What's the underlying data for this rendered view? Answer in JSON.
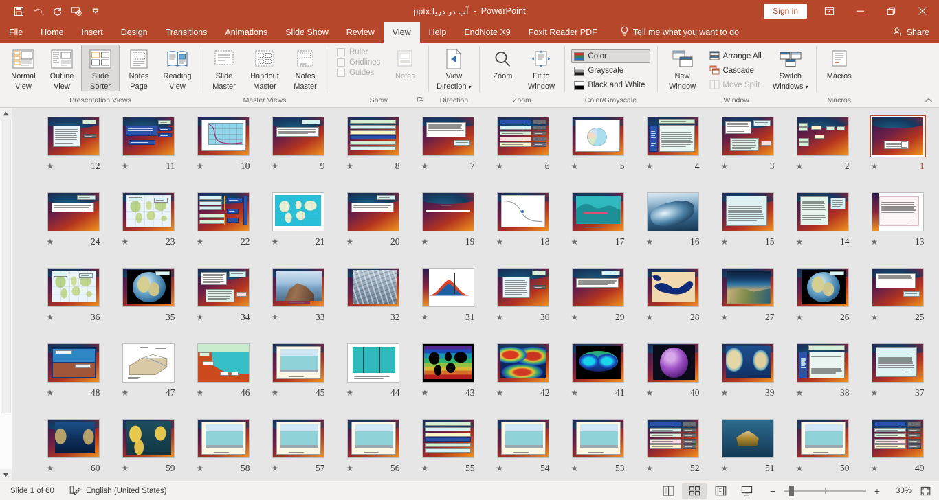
{
  "app": {
    "title_document": "آب در دریا.pptx",
    "title_separator": "-",
    "title_app": "PowerPoint",
    "accent_color": "#b7472a",
    "canvas_color": "#e6e6e6"
  },
  "quick_access": [
    {
      "name": "save-button",
      "icon": "save-icon",
      "enabled": true
    },
    {
      "name": "undo-button",
      "icon": "undo-icon",
      "enabled": false
    },
    {
      "name": "redo-button",
      "icon": "redo-icon",
      "enabled": true
    },
    {
      "name": "start-presentation-button",
      "icon": "present-icon",
      "enabled": true
    },
    {
      "name": "customize-qat-button",
      "icon": "chevron-down-icon",
      "enabled": true
    }
  ],
  "titlebar": {
    "sign_in_label": "Sign in",
    "ribbon_display_icon": "ribbon-display-options-icon",
    "minimize_icon": "minimize-icon",
    "restore_icon": "restore-icon",
    "close_icon": "close-icon"
  },
  "tabs": [
    {
      "label": "File",
      "active": false
    },
    {
      "label": "Home",
      "active": false
    },
    {
      "label": "Insert",
      "active": false
    },
    {
      "label": "Design",
      "active": false
    },
    {
      "label": "Transitions",
      "active": false
    },
    {
      "label": "Animations",
      "active": false
    },
    {
      "label": "Slide Show",
      "active": false
    },
    {
      "label": "Review",
      "active": false
    },
    {
      "label": "View",
      "active": true
    },
    {
      "label": "Help",
      "active": false
    },
    {
      "label": "EndNote X9",
      "active": false
    },
    {
      "label": "Foxit Reader PDF",
      "active": false
    }
  ],
  "tell_me": {
    "label": "Tell me what you want to do",
    "icon": "lightbulb-icon"
  },
  "share": {
    "label": "Share",
    "icon": "share-person-icon"
  },
  "ribbon": {
    "groups": [
      {
        "label": "Presentation Views",
        "buttons": [
          {
            "label_top": "Normal",
            "label_bottom": "View",
            "icon": "normal-view-icon",
            "selected": false,
            "enabled": true
          },
          {
            "label_top": "Outline",
            "label_bottom": "View",
            "icon": "outline-view-icon",
            "selected": false,
            "enabled": true
          },
          {
            "label_top": "Slide",
            "label_bottom": "Sorter",
            "icon": "slide-sorter-icon",
            "selected": true,
            "enabled": true
          },
          {
            "label_top": "Notes",
            "label_bottom": "Page",
            "icon": "notes-page-icon",
            "selected": false,
            "enabled": true
          },
          {
            "label_top": "Reading",
            "label_bottom": "View",
            "icon": "reading-view-icon",
            "selected": false,
            "enabled": true
          }
        ]
      },
      {
        "label": "Master Views",
        "buttons": [
          {
            "label_top": "Slide",
            "label_bottom": "Master",
            "icon": "slide-master-icon",
            "selected": false,
            "enabled": true
          },
          {
            "label_top": "Handout",
            "label_bottom": "Master",
            "icon": "handout-master-icon",
            "selected": false,
            "enabled": true
          },
          {
            "label_top": "Notes",
            "label_bottom": "Master",
            "icon": "notes-master-icon",
            "selected": false,
            "enabled": true
          }
        ]
      },
      {
        "label": "Show",
        "has_dialog_launcher": true,
        "checkboxes": [
          {
            "label": "Ruler",
            "checked": false,
            "enabled": false
          },
          {
            "label": "Gridlines",
            "checked": false,
            "enabled": false
          },
          {
            "label": "Guides",
            "checked": false,
            "enabled": false
          }
        ],
        "buttons": [
          {
            "label_top": "Notes",
            "label_bottom": "",
            "icon": "notes-icon",
            "selected": false,
            "enabled": false
          }
        ]
      },
      {
        "label": "Direction",
        "buttons": [
          {
            "label_top": "View",
            "label_bottom": "Direction",
            "icon": "view-direction-icon",
            "has_dropdown": true,
            "selected": false,
            "enabled": true
          }
        ]
      },
      {
        "label": "Zoom",
        "buttons": [
          {
            "label_top": "Zoom",
            "label_bottom": "",
            "icon": "magnifier-icon",
            "selected": false,
            "enabled": true
          },
          {
            "label_top": "Fit to",
            "label_bottom": "Window",
            "icon": "fit-to-window-icon",
            "selected": false,
            "enabled": true
          }
        ]
      },
      {
        "label": "Color/Grayscale",
        "small_buttons": [
          {
            "label": "Color",
            "icon": "color-swatch-icon",
            "selected": true,
            "enabled": true
          },
          {
            "label": "Grayscale",
            "icon": "grayscale-swatch-icon",
            "selected": false,
            "enabled": true
          },
          {
            "label": "Black and White",
            "icon": "blackwhite-swatch-icon",
            "selected": false,
            "enabled": true
          }
        ]
      },
      {
        "label": "Window",
        "buttons": [
          {
            "label_top": "New",
            "label_bottom": "Window",
            "icon": "new-window-icon",
            "selected": false,
            "enabled": true
          },
          {
            "label_top": "Switch",
            "label_bottom": "Windows",
            "icon": "switch-windows-icon",
            "has_dropdown": true,
            "selected": false,
            "enabled": true
          }
        ],
        "small_buttons": [
          {
            "label": "Arrange All",
            "icon": "arrange-all-icon",
            "selected": false,
            "enabled": true
          },
          {
            "label": "Cascade",
            "icon": "cascade-icon",
            "selected": false,
            "enabled": true
          },
          {
            "label": "Move Split",
            "icon": "move-split-icon",
            "selected": false,
            "enabled": false
          }
        ]
      },
      {
        "label": "Macros",
        "buttons": [
          {
            "label_top": "Macros",
            "label_bottom": "",
            "icon": "macros-icon",
            "selected": false,
            "enabled": true
          }
        ]
      }
    ],
    "collapse_icon": "chevron-up-icon"
  },
  "sorter": {
    "selected_slide": 1,
    "rtl": true,
    "slides": [
      {
        "n": 1,
        "star": true,
        "style": "title-slide",
        "selected": true
      },
      {
        "n": 2,
        "star": true,
        "style": "diagram-boxes"
      },
      {
        "n": 3,
        "star": true,
        "style": "two-text-boxes"
      },
      {
        "n": 4,
        "star": true,
        "style": "blue-list"
      },
      {
        "n": 5,
        "star": true,
        "style": "pie-chart"
      },
      {
        "n": 6,
        "star": true,
        "style": "table-rows"
      },
      {
        "n": 7,
        "star": true,
        "style": "text-dark"
      },
      {
        "n": 8,
        "star": true,
        "style": "table-green"
      },
      {
        "n": 9,
        "star": true,
        "style": "text-block"
      },
      {
        "n": 10,
        "star": true,
        "style": "profile-chart"
      },
      {
        "n": 11,
        "star": true,
        "style": "blue-buttons"
      },
      {
        "n": 12,
        "star": true,
        "style": "text-white-box"
      },
      {
        "n": 13,
        "star": true,
        "style": "pink-text"
      },
      {
        "n": 14,
        "star": true,
        "style": "text-green"
      },
      {
        "n": 15,
        "star": true,
        "style": "text-cyan"
      },
      {
        "n": 16,
        "star": true,
        "style": "photo-wave"
      },
      {
        "n": 17,
        "star": true,
        "style": "sea-profile"
      },
      {
        "n": 18,
        "star": true,
        "style": "scurve-chart"
      },
      {
        "n": 19,
        "star": true,
        "style": "bar-white"
      },
      {
        "n": 20,
        "star": true,
        "style": "text-block"
      },
      {
        "n": 21,
        "star": true,
        "style": "map-ocean"
      },
      {
        "n": 22,
        "star": true,
        "style": "diagram-brace"
      },
      {
        "n": 23,
        "star": true,
        "style": "map-world"
      },
      {
        "n": 24,
        "star": true,
        "style": "text-block"
      },
      {
        "n": 25,
        "star": true,
        "style": "text-dark"
      },
      {
        "n": 26,
        "star": true,
        "style": "globe-dark"
      },
      {
        "n": 27,
        "star": true,
        "style": "photo-coast"
      },
      {
        "n": 28,
        "star": true,
        "style": "map-medit"
      },
      {
        "n": 29,
        "star": true,
        "style": "text-block"
      },
      {
        "n": 30,
        "star": true,
        "style": "text-white-box"
      },
      {
        "n": 31,
        "star": true,
        "style": "section-diagram"
      },
      {
        "n": 32,
        "star": false,
        "style": "photo-city"
      },
      {
        "n": 33,
        "star": true,
        "style": "photo-rock"
      },
      {
        "n": 34,
        "star": true,
        "style": "two-text-boxes"
      },
      {
        "n": 35,
        "star": false,
        "style": "globe-dark"
      },
      {
        "n": 36,
        "star": true,
        "style": "map-world"
      },
      {
        "n": 37,
        "star": true,
        "style": "text-cyan"
      },
      {
        "n": 38,
        "star": true,
        "style": "blue-list"
      },
      {
        "n": 39,
        "star": true,
        "style": "map-bathy"
      },
      {
        "n": 40,
        "star": true,
        "style": "map-purple"
      },
      {
        "n": 41,
        "star": true,
        "style": "map-ellipse"
      },
      {
        "n": 42,
        "star": true,
        "style": "map-salin"
      },
      {
        "n": 43,
        "star": true,
        "style": "map-sst"
      },
      {
        "n": 44,
        "star": true,
        "style": "profile-deep"
      },
      {
        "n": 45,
        "star": true,
        "style": "sea-chart"
      },
      {
        "n": 46,
        "star": true,
        "style": "shelf-diagram"
      },
      {
        "n": 47,
        "star": true,
        "style": "shelf-sketch"
      },
      {
        "n": 48,
        "star": true,
        "style": "shelf-labeled"
      },
      {
        "n": 49,
        "star": true,
        "style": "table-rows"
      },
      {
        "n": 50,
        "star": true,
        "style": "sea-chart"
      },
      {
        "n": 51,
        "star": true,
        "style": "photo-rig"
      },
      {
        "n": 52,
        "star": true,
        "style": "table-grid"
      },
      {
        "n": 53,
        "star": true,
        "style": "sea-chart"
      },
      {
        "n": 54,
        "star": true,
        "style": "sea-chart"
      },
      {
        "n": 55,
        "star": true,
        "style": "table-green"
      },
      {
        "n": 56,
        "star": true,
        "style": "sea-chart"
      },
      {
        "n": 57,
        "star": true,
        "style": "sea-chart"
      },
      {
        "n": 58,
        "star": true,
        "style": "sea-chart"
      },
      {
        "n": 59,
        "star": true,
        "style": "map-plate"
      },
      {
        "n": 60,
        "star": true,
        "style": "map-atl"
      }
    ]
  },
  "statusbar": {
    "slide_indicator": "Slide 1 of 60",
    "language": "English (United States)",
    "notes_icon": "spelling-icon",
    "views": [
      {
        "name": "normal-view-button",
        "icon": "normal-view-small-icon",
        "active": false
      },
      {
        "name": "slide-sorter-view-button",
        "icon": "slide-sorter-small-icon",
        "active": true
      },
      {
        "name": "reading-view-button",
        "icon": "reading-view-small-icon",
        "active": false
      },
      {
        "name": "slideshow-view-button",
        "icon": "slideshow-small-icon",
        "active": false
      }
    ],
    "zoom_out_label": "−",
    "zoom_in_label": "+",
    "zoom_level": "30%",
    "fit_icon": "fit-slide-icon"
  }
}
